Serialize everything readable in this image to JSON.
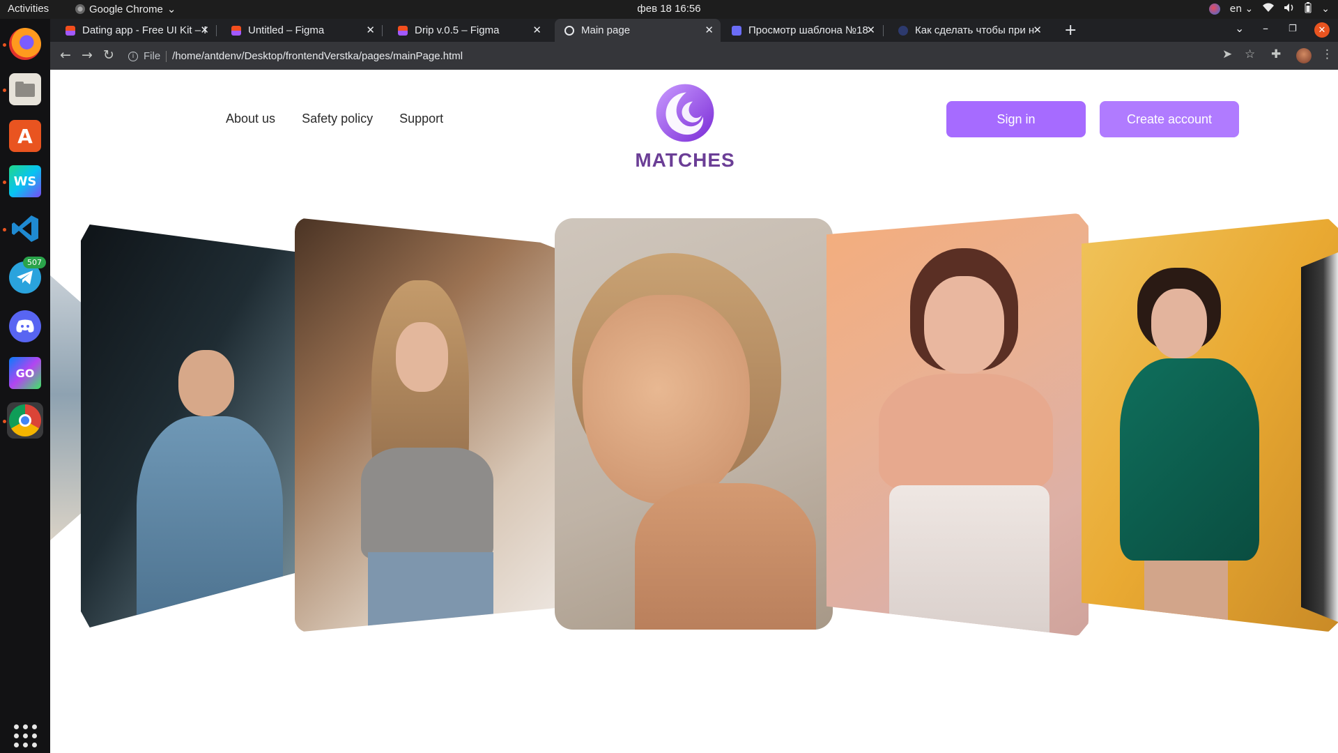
{
  "os": {
    "activities_label": "Activities",
    "app_menu_label": "Google Chrome",
    "clock": "фев 18  16:56",
    "keyboard_layout": "en",
    "dock_badge_count": "507"
  },
  "browser": {
    "tabs": [
      {
        "title": "Dating app - Free UI Kit – F",
        "favicon": "figma-icon"
      },
      {
        "title": "Untitled – Figma",
        "favicon": "figma-icon"
      },
      {
        "title": "Drip v.0.5 – Figma",
        "favicon": "figma-icon"
      },
      {
        "title": "Main page",
        "favicon": "globe-icon",
        "active": true
      },
      {
        "title": "Просмотр шаблона №18",
        "favicon": "template-icon"
      },
      {
        "title": "Как сделать чтобы при н",
        "favicon": "chat-icon"
      }
    ],
    "address": {
      "scheme": "File",
      "path": "/home/antdenv/Desktop/frontendVerstka/pages/mainPage.html"
    }
  },
  "site": {
    "nav": {
      "about": "About us",
      "safety": "Safety policy",
      "support": "Support"
    },
    "logo_text": "MATCHES",
    "sign_in": "Sign in",
    "create_account": "Create account",
    "accent_color": "#a463ff",
    "logo_color": "#6b3e96"
  }
}
